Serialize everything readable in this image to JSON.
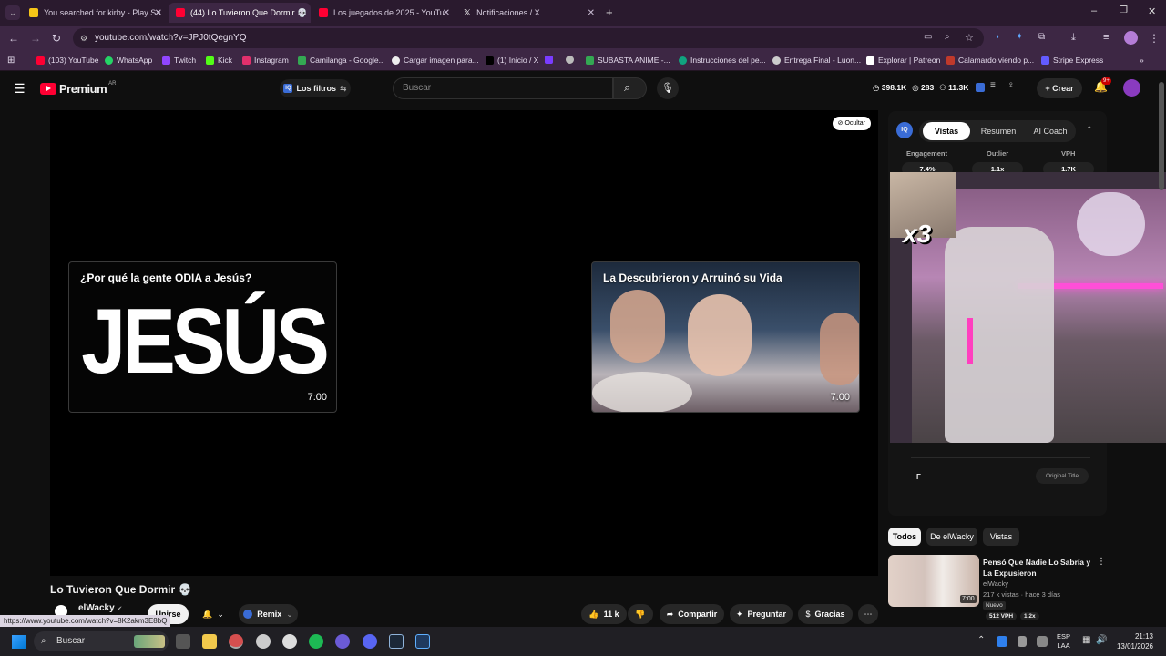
{
  "browser": {
    "tabs": [
      {
        "label": "You searched for kirby - Play Sa",
        "color": "#f5c518"
      },
      {
        "label": "(44) Lo Tuvieron Que Dormir 💀",
        "color": "#ff0033"
      },
      {
        "label": "Los juegados de 2025 - YouTu",
        "color": "#ff0033"
      },
      {
        "label": "Notificaciones / X",
        "color": "#ffffff"
      }
    ],
    "url": "youtube.com/watch?v=JPJ0tQegnYQ",
    "bookmarks": [
      "(103) YouTube",
      "WhatsApp",
      "Twitch",
      "Kick",
      "Instagram",
      "Camilanga - Google...",
      "Cargar imagen para...",
      "(1) Inicio / X",
      "SUBASTA ANIME -...",
      "Instrucciones del pe...",
      "Entrega Final - Luon...",
      "Explorar | Patreon",
      "Calamardo viendo p...",
      "Stripe Express"
    ]
  },
  "youtube": {
    "logo": "Premium",
    "region": "AR",
    "filters_label": "Los filtros",
    "search_placeholder": "Buscar",
    "stats": {
      "a": "398.1K",
      "b": "283",
      "c": "11.3K"
    },
    "create_label": "Crear",
    "notif_count": "9+"
  },
  "player": {
    "hide_label": "Ocultar",
    "end_cards": [
      {
        "title": "¿Por qué la gente ODIA a Jesús?",
        "big": "JESÚS",
        "duration": "7:00"
      },
      {
        "title": "La Descubrieron y Arruinó su Vida",
        "duration": "7:00"
      }
    ]
  },
  "video": {
    "title": "Lo Tuvieron Que Dormir 💀",
    "channel": "elWacky",
    "join_label": "Unirse",
    "remix_label": "Remix",
    "likes": "11 k",
    "share_label": "Compartir",
    "ask_label": "Preguntar",
    "thanks_label": "Gracias"
  },
  "sidepanel": {
    "tabs": [
      "Vistas",
      "Resumen",
      "AI Coach"
    ],
    "metrics": [
      {
        "label": "Engagement",
        "value": "7.4%"
      },
      {
        "label": "Outlier",
        "value": "1.1x"
      },
      {
        "label": "VPH",
        "value": "1.7K"
      }
    ],
    "overlay_text": "x3",
    "row_label": "F",
    "row_button": "Original Title"
  },
  "filters": [
    "Todos",
    "De elWacky",
    "Vistas"
  ],
  "recommended": {
    "title": "Pensó Que Nadie Lo Sabría y La Expusieron",
    "channel": "elWacky",
    "meta": "217 k vistas · hace 3 días",
    "badge": "Nuevo",
    "vph": "512 VPH",
    "ratio": "1.2x",
    "duration": "7:00"
  },
  "status_url": "https://www.youtube.com/watch?v=8K2akm3E8bQ",
  "taskbar": {
    "search": "Buscar",
    "lang": "ESP",
    "lang2": "LAA",
    "time": "21:13",
    "date": "13/01/2026"
  }
}
